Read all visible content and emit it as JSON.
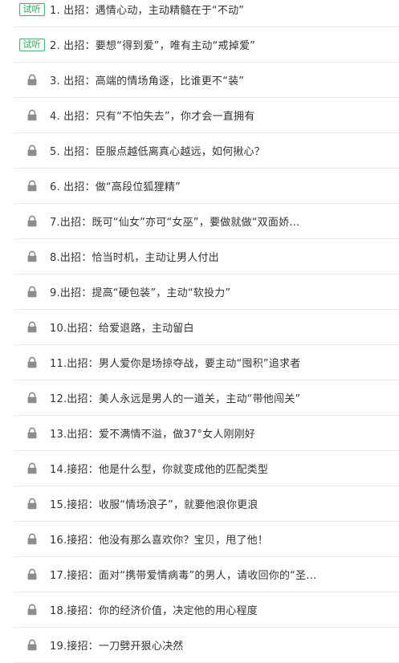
{
  "trial_label": "试听",
  "icons": {
    "locked": "lock-icon",
    "lock_color": "#8c8c8c",
    "trial_color": "#2e9e55"
  },
  "lessons": [
    {
      "title": "1. 出招：遇情心动，主动精髓在于“不动”",
      "status": "trial"
    },
    {
      "title": "2. 出招：要想“得到爱”，唯有主动“戒掉爱”",
      "status": "trial"
    },
    {
      "title": "3. 出招：高端的情场角逐，比谁更不“装”",
      "status": "locked"
    },
    {
      "title": "4. 出招：只有“不怕失去”，你才会一直拥有",
      "status": "locked"
    },
    {
      "title": "5. 出招：臣服点越低离真心越远，如何揪心？",
      "status": "locked"
    },
    {
      "title": "6. 出招：做“高段位狐狸精”",
      "status": "locked"
    },
    {
      "title": "7.出招：既可“仙女”亦可“女巫”，要做就做“双面娇...",
      "status": "locked"
    },
    {
      "title": "8.出招：恰当时机，主动让男人付出",
      "status": "locked"
    },
    {
      "title": "9.出招：提高“硬包装”，主动“软投力”",
      "status": "locked"
    },
    {
      "title": "10.出招：给爱退路，主动留白",
      "status": "locked"
    },
    {
      "title": "11.出招：男人爱你是场掠夺战，要主动“囤积”追求者",
      "status": "locked"
    },
    {
      "title": "12.出招：美人永远是男人的一道关，主动“带他闯关”",
      "status": "locked"
    },
    {
      "title": "13.出招：爱不满情不溢，做37°女人刚刚好",
      "status": "locked"
    },
    {
      "title": "14.接招：他是什么型，你就变成他的匹配类型",
      "status": "locked"
    },
    {
      "title": "15.接招：收服“情场浪子”，就要他浪你更浪",
      "status": "locked"
    },
    {
      "title": "16.接招：他没有那么喜欢你？宝贝，甩了他！",
      "status": "locked"
    },
    {
      "title": "17.接招：面对“携带爱情病毒”的男人，请收回你的“圣...",
      "status": "locked"
    },
    {
      "title": "18.接招：你的经济价值，决定他的用心程度",
      "status": "locked"
    },
    {
      "title": "19.接招：一刀劈开狠心决然",
      "status": "locked"
    }
  ]
}
